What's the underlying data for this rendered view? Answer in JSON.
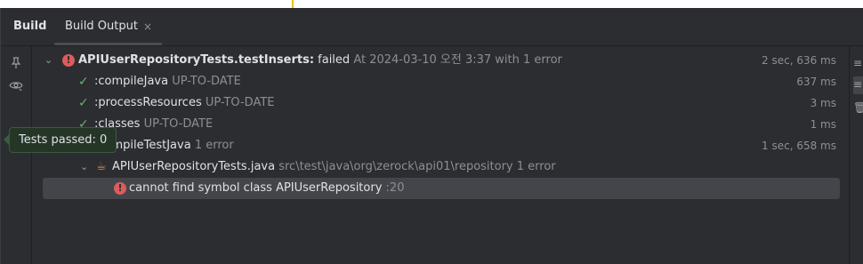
{
  "tabs": {
    "build_label": "Build",
    "output_label": "Build Output",
    "close_glyph": "×"
  },
  "tree": {
    "root": {
      "name": "APIUserRepositoryTests.testInserts:",
      "status": "failed",
      "detail": "At 2024-03-10 오전 3:37 with 1 error",
      "time": "2 sec, 636 ms"
    },
    "compile_java": {
      "name": ":compileJava",
      "status": "UP-TO-DATE",
      "time": "637 ms"
    },
    "process_resources": {
      "name": ":processResources",
      "status": "UP-TO-DATE",
      "time": "3 ms"
    },
    "classes": {
      "name": ":classes",
      "status": "UP-TO-DATE",
      "time": "1 ms"
    },
    "compile_test_java": {
      "name": ":compileTestJava",
      "status": "1 error",
      "time": "1 sec, 658 ms"
    },
    "file": {
      "name": "APIUserRepositoryTests.java",
      "path": "src\\test\\java\\org\\zerock\\api01\\repository",
      "status": "1 error"
    },
    "error": {
      "message": "cannot find symbol class APIUserRepository",
      "line": ":20"
    }
  },
  "tooltip": {
    "text": "Tests passed: 0"
  },
  "icons": {
    "pin": "pin-icon",
    "eye": "eye-icon",
    "error": "error-icon",
    "check": "check-icon",
    "java_file": "java-file-icon"
  },
  "colors": {
    "background": "#2b2d30",
    "error": "#db5c5c",
    "success": "#5fb865",
    "tooltip_bg": "#253627",
    "selected_row": "#43454a"
  }
}
